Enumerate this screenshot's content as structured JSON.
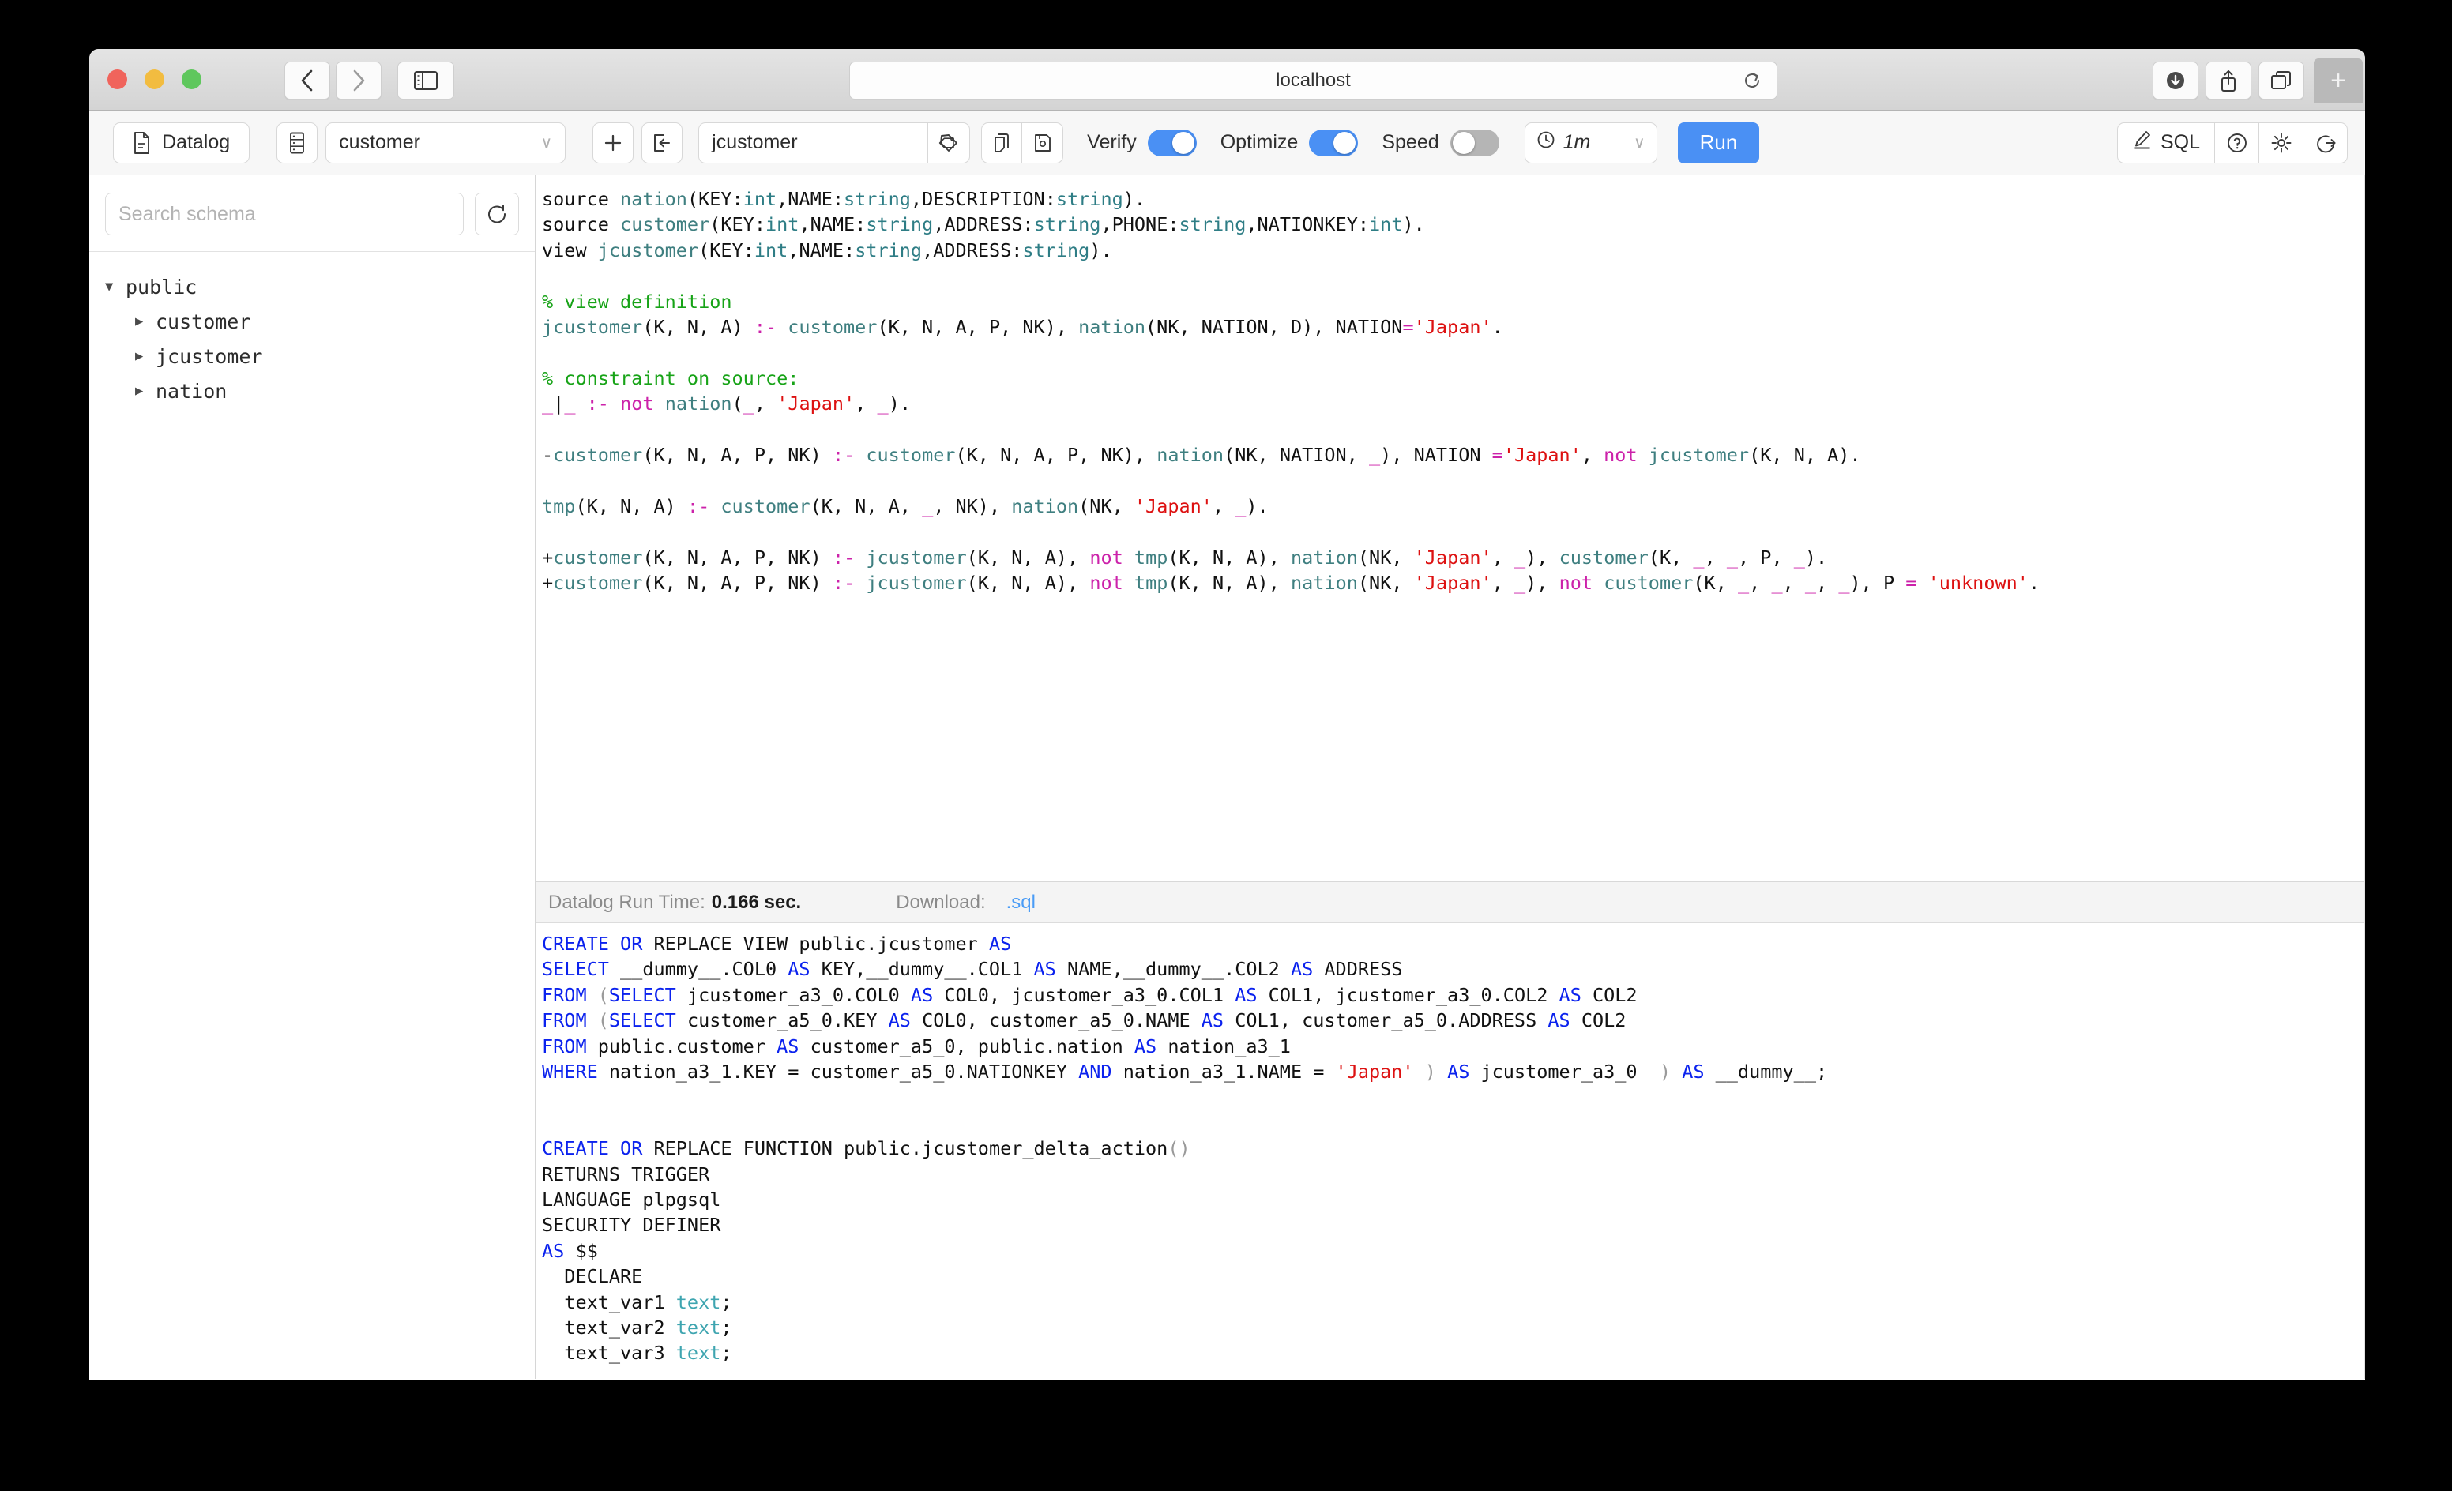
{
  "browser": {
    "url": "localhost",
    "nav": {
      "back": "‹",
      "forward": "›"
    },
    "icons": {
      "back_icon": "chevron-left-icon",
      "forward_icon": "chevron-right-icon",
      "sidebar_icon": "sidebar-toggle-icon",
      "reload_icon": "reload-icon",
      "downloads_icon": "downloads-icon",
      "share_icon": "share-icon",
      "tabs_icon": "tab-overview-icon",
      "newtab_label": "+"
    }
  },
  "toolbar": {
    "language_label": "Datalog",
    "source_table": "customer",
    "view_name": "jcustomer",
    "add_label": "+",
    "verify_label": "Verify",
    "verify_on": true,
    "optimize_label": "Optimize",
    "optimize_on": true,
    "speed_label": "Speed",
    "speed_on": false,
    "timeout_value": "1m",
    "run_label": "Run",
    "sql_label": "SQL",
    "caret": "∨",
    "icons": {
      "file_icon": "document-icon",
      "database_icon": "database-icon",
      "plus_icon": "plus-icon",
      "import_icon": "import-icon",
      "tag_icon": "tag-icon",
      "copy_icon": "copy-icon",
      "save_icon": "save-disk-icon",
      "clock_icon": "clock-icon",
      "pencil_icon": "pencil-icon",
      "help_icon": "help-circle-icon",
      "settings_icon": "gear-icon",
      "logout_icon": "logout-icon"
    }
  },
  "schema": {
    "search_placeholder": "Search schema",
    "refresh_icon": "refresh-icon",
    "root": "public",
    "tables": [
      "customer",
      "jcustomer",
      "nation"
    ]
  },
  "status": {
    "runtime_label": "Datalog Run Time:",
    "runtime_value": "0.166 sec.",
    "download_label": "Download:",
    "download_link": "​.sql"
  },
  "colors": {
    "accent": "#4a90f4",
    "toggle_off": "#b5b5b5",
    "link": "#4a9cf6",
    "comment": "#17a317",
    "string": "#dd1111",
    "operator": "#cc22aa",
    "predicate": "#3f7f80",
    "sql_keyword": "#0b22ee",
    "sql_type": "#3fa5b0"
  },
  "datalog_lines": [
    "source nation(KEY:int,NAME:string,DESCRIPTION:string).",
    "source customer(KEY:int,NAME:string,ADDRESS:string,PHONE:string,NATIONKEY:int).",
    "view jcustomer(KEY:int,NAME:string,ADDRESS:string).",
    "",
    "% view definition",
    "jcustomer(K, N, A) :- customer(K, N, A, P, NK), nation(NK, NATION, D), NATION='Japan'.",
    "",
    "% constraint on source:",
    "_|_ :- not nation(_, 'Japan', _).",
    "",
    "-customer(K, N, A, P, NK) :- customer(K, N, A, P, NK), nation(NK, NATION, _), NATION ='Japan', not jcustomer(K, N, A).",
    "",
    "tmp(K, N, A) :- customer(K, N, A, _, NK), nation(NK, 'Japan', _).",
    "",
    "+customer(K, N, A, P, NK) :- jcustomer(K, N, A), not tmp(K, N, A), nation(NK, 'Japan', _), customer(K, _, _, P, _).",
    "+customer(K, N, A, P, NK) :- jcustomer(K, N, A), not tmp(K, N, A), nation(NK, 'Japan', _), not customer(K, _, _, _, _), P = 'unknown'."
  ],
  "sql_lines": [
    "CREATE OR REPLACE VIEW public.jcustomer AS",
    "SELECT __dummy__.COL0 AS KEY,__dummy__.COL1 AS NAME,__dummy__.COL2 AS ADDRESS",
    "FROM (SELECT jcustomer_a3_0.COL0 AS COL0, jcustomer_a3_0.COL1 AS COL1, jcustomer_a3_0.COL2 AS COL2",
    "FROM (SELECT customer_a5_0.KEY AS COL0, customer_a5_0.NAME AS COL1, customer_a5_0.ADDRESS AS COL2",
    "FROM public.customer AS customer_a5_0, public.nation AS nation_a3_1",
    "WHERE nation_a3_1.KEY = customer_a5_0.NATIONKEY AND nation_a3_1.NAME = 'Japan' ) AS jcustomer_a3_0  ) AS __dummy__;",
    "",
    "",
    "CREATE OR REPLACE FUNCTION public.jcustomer_delta_action()",
    "RETURNS TRIGGER",
    "LANGUAGE plpgsql",
    "SECURITY DEFINER",
    "AS $$",
    "  DECLARE",
    "  text_var1 text;",
    "  text_var2 text;",
    "  text_var3 text;"
  ]
}
